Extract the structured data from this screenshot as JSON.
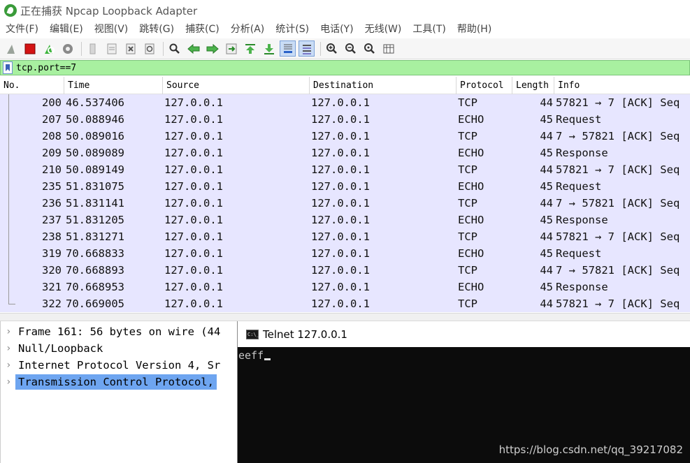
{
  "window": {
    "title": "正在捕获 Npcap Loopback Adapter"
  },
  "menu": [
    "文件(F)",
    "编辑(E)",
    "视图(V)",
    "跳转(G)",
    "捕获(C)",
    "分析(A)",
    "统计(S)",
    "电话(Y)",
    "无线(W)",
    "工具(T)",
    "帮助(H)"
  ],
  "filter": {
    "value": "tcp.port==7"
  },
  "columns": {
    "no": "No.",
    "time": "Time",
    "source": "Source",
    "destination": "Destination",
    "protocol": "Protocol",
    "length": "Length",
    "info": "Info"
  },
  "packets": [
    {
      "no": "200",
      "time": "46.537406",
      "source": "127.0.0.1",
      "destination": "127.0.0.1",
      "protocol": "TCP",
      "length": "44",
      "info": "57821 → 7 [ACK] Seq"
    },
    {
      "no": "207",
      "time": "50.088946",
      "source": "127.0.0.1",
      "destination": "127.0.0.1",
      "protocol": "ECHO",
      "length": "45",
      "info": "Request"
    },
    {
      "no": "208",
      "time": "50.089016",
      "source": "127.0.0.1",
      "destination": "127.0.0.1",
      "protocol": "TCP",
      "length": "44",
      "info": "7 → 57821 [ACK] Seq"
    },
    {
      "no": "209",
      "time": "50.089089",
      "source": "127.0.0.1",
      "destination": "127.0.0.1",
      "protocol": "ECHO",
      "length": "45",
      "info": "Response"
    },
    {
      "no": "210",
      "time": "50.089149",
      "source": "127.0.0.1",
      "destination": "127.0.0.1",
      "protocol": "TCP",
      "length": "44",
      "info": "57821 → 7 [ACK] Seq"
    },
    {
      "no": "235",
      "time": "51.831075",
      "source": "127.0.0.1",
      "destination": "127.0.0.1",
      "protocol": "ECHO",
      "length": "45",
      "info": "Request"
    },
    {
      "no": "236",
      "time": "51.831141",
      "source": "127.0.0.1",
      "destination": "127.0.0.1",
      "protocol": "TCP",
      "length": "44",
      "info": "7 → 57821 [ACK] Seq"
    },
    {
      "no": "237",
      "time": "51.831205",
      "source": "127.0.0.1",
      "destination": "127.0.0.1",
      "protocol": "ECHO",
      "length": "45",
      "info": "Response"
    },
    {
      "no": "238",
      "time": "51.831271",
      "source": "127.0.0.1",
      "destination": "127.0.0.1",
      "protocol": "TCP",
      "length": "44",
      "info": "57821 → 7 [ACK] Seq"
    },
    {
      "no": "319",
      "time": "70.668833",
      "source": "127.0.0.1",
      "destination": "127.0.0.1",
      "protocol": "ECHO",
      "length": "45",
      "info": "Request"
    },
    {
      "no": "320",
      "time": "70.668893",
      "source": "127.0.0.1",
      "destination": "127.0.0.1",
      "protocol": "TCP",
      "length": "44",
      "info": "7 → 57821 [ACK] Seq"
    },
    {
      "no": "321",
      "time": "70.668953",
      "source": "127.0.0.1",
      "destination": "127.0.0.1",
      "protocol": "ECHO",
      "length": "45",
      "info": "Response"
    },
    {
      "no": "322",
      "time": "70.669005",
      "source": "127.0.0.1",
      "destination": "127.0.0.1",
      "protocol": "TCP",
      "length": "44",
      "info": "57821 → 7 [ACK] Seq"
    }
  ],
  "details": [
    {
      "text": "Frame 161: 56 bytes on wire (44",
      "selected": false
    },
    {
      "text": "Null/Loopback",
      "selected": false
    },
    {
      "text": "Internet Protocol Version 4, Sr",
      "selected": false
    },
    {
      "text": "Transmission Control Protocol,",
      "selected": true
    }
  ],
  "telnet": {
    "title": "Telnet 127.0.0.1",
    "icon_text": "C:\\_",
    "content": "eeff"
  },
  "watermark": "https://blog.csdn.net/qq_39217082",
  "colors": {
    "row_bg": "#e7e6ff",
    "filter_bg": "#a8f0a0",
    "selected_bg": "#6ea5f0",
    "terminal_bg": "#0c0c0c"
  },
  "icons": [
    "shark-fin-icon",
    "stop-icon",
    "restart-icon",
    "options-gear-icon",
    "open-file-icon",
    "save-file-icon",
    "close-file-icon",
    "reload-icon",
    "search-icon",
    "back-arrow-icon",
    "forward-arrow-icon",
    "goto-packet-icon",
    "first-packet-icon",
    "last-packet-icon",
    "autoscroll-icon",
    "colorize-icon",
    "zoom-in-icon",
    "zoom-out-icon",
    "zoom-reset-icon",
    "resize-columns-icon"
  ]
}
